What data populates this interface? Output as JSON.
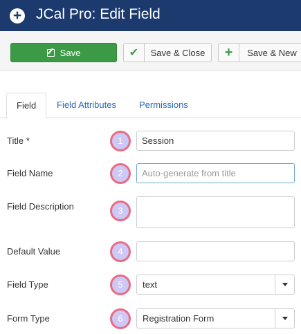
{
  "header": {
    "title": "JCal Pro: Edit Field",
    "icon": "plus-circle-icon"
  },
  "toolbar": {
    "save_label": "Save",
    "save_close_label": "Save & Close",
    "save_new_label": "Save & New",
    "check_glyph": "✔",
    "plus_glyph": "+"
  },
  "tabs": [
    {
      "label": "Field",
      "active": true
    },
    {
      "label": "Field Attributes",
      "active": false
    },
    {
      "label": "Permissions",
      "active": false
    }
  ],
  "fields": [
    {
      "label": "Title *",
      "badge": "1",
      "value": "Session",
      "placeholder": ""
    },
    {
      "label": "Field Name",
      "badge": "2",
      "value": "",
      "placeholder": "Auto-generate from title"
    },
    {
      "label": "Field Description",
      "badge": "3",
      "value": "",
      "placeholder": ""
    },
    {
      "label": "Default Value",
      "badge": "4",
      "value": "",
      "placeholder": ""
    },
    {
      "label": "Field Type",
      "badge": "5",
      "value": "text"
    },
    {
      "label": "Form Type",
      "badge": "6",
      "value": "Registration Form"
    }
  ],
  "colors": {
    "header_bg": "#1c3a6e",
    "save_bg": "#3c9a47",
    "badge_border": "#ea6b83",
    "badge_fill": "#cdc8f5",
    "link": "#2a69b8"
  }
}
